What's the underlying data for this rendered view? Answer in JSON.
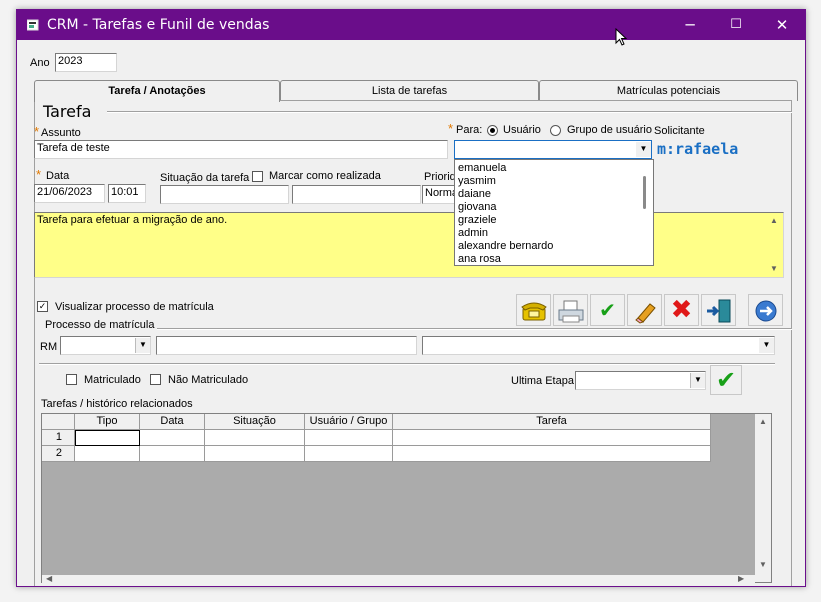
{
  "window": {
    "title": "CRM - Tarefas e Funil de vendas",
    "minimize": "─",
    "maximize": "☐",
    "close": "✕"
  },
  "ano": {
    "label": "Ano",
    "value": "2023"
  },
  "tabs": [
    {
      "label": "Tarefa / Anotações",
      "active": true
    },
    {
      "label": "Lista de tarefas",
      "active": false
    },
    {
      "label": "Matrículas potenciais",
      "active": false
    }
  ],
  "tarefa": {
    "group_title": "Tarefa",
    "assunto_label": "Assunto",
    "assunto_value": "Tarefa de teste",
    "required_mark": "*",
    "para_label": "Para:",
    "para_options": [
      "Usuário",
      "Grupo de usuário"
    ],
    "para_selected": "Usuário",
    "solicitante_label": "Solicitante",
    "solicitante_value": "m:rafaela",
    "data_label": "Data",
    "data_value": "21/06/2023",
    "hora_value": "10:01",
    "situacao_label": "Situação da tarefa",
    "marcar_label": "Marcar como realizada",
    "prioridade_label": "Priorid",
    "prioridade_value": "Norma",
    "description": "Tarefa para efetuar a migração de ano.",
    "dropdown_items": [
      "emanuela",
      "yasmim",
      "daiane",
      "giovana",
      "graziele",
      "admin",
      "alexandre bernardo",
      "ana rosa"
    ]
  },
  "toolbar": {
    "icons": [
      "telephone-icon",
      "printer-icon",
      "confirm-check-icon",
      "eraser-icon",
      "cancel-x-icon",
      "exit-door-icon",
      "next-arrow-icon"
    ]
  },
  "processo": {
    "visualizar_label": "Visualizar processo de matrícula",
    "visualizar_checked": true,
    "group_title": "Processo de matrícula",
    "rm_label": "RM",
    "matriculado_label": "Matriculado",
    "nao_matriculado_label": "Não Matriculado",
    "ultima_etapa_label": "Ultima Etapa"
  },
  "historico": {
    "title": "Tarefas / histórico relacionados",
    "columns": [
      "Tipo",
      "Data",
      "Situação",
      "Usuário / Grupo",
      "Tarefa"
    ],
    "rows": [
      "1",
      "2"
    ]
  },
  "colors": {
    "titlebar": "#6a0d8a",
    "note_background": "#ffff88",
    "solicitante": "#1a6fc4",
    "required": "#e07800"
  }
}
